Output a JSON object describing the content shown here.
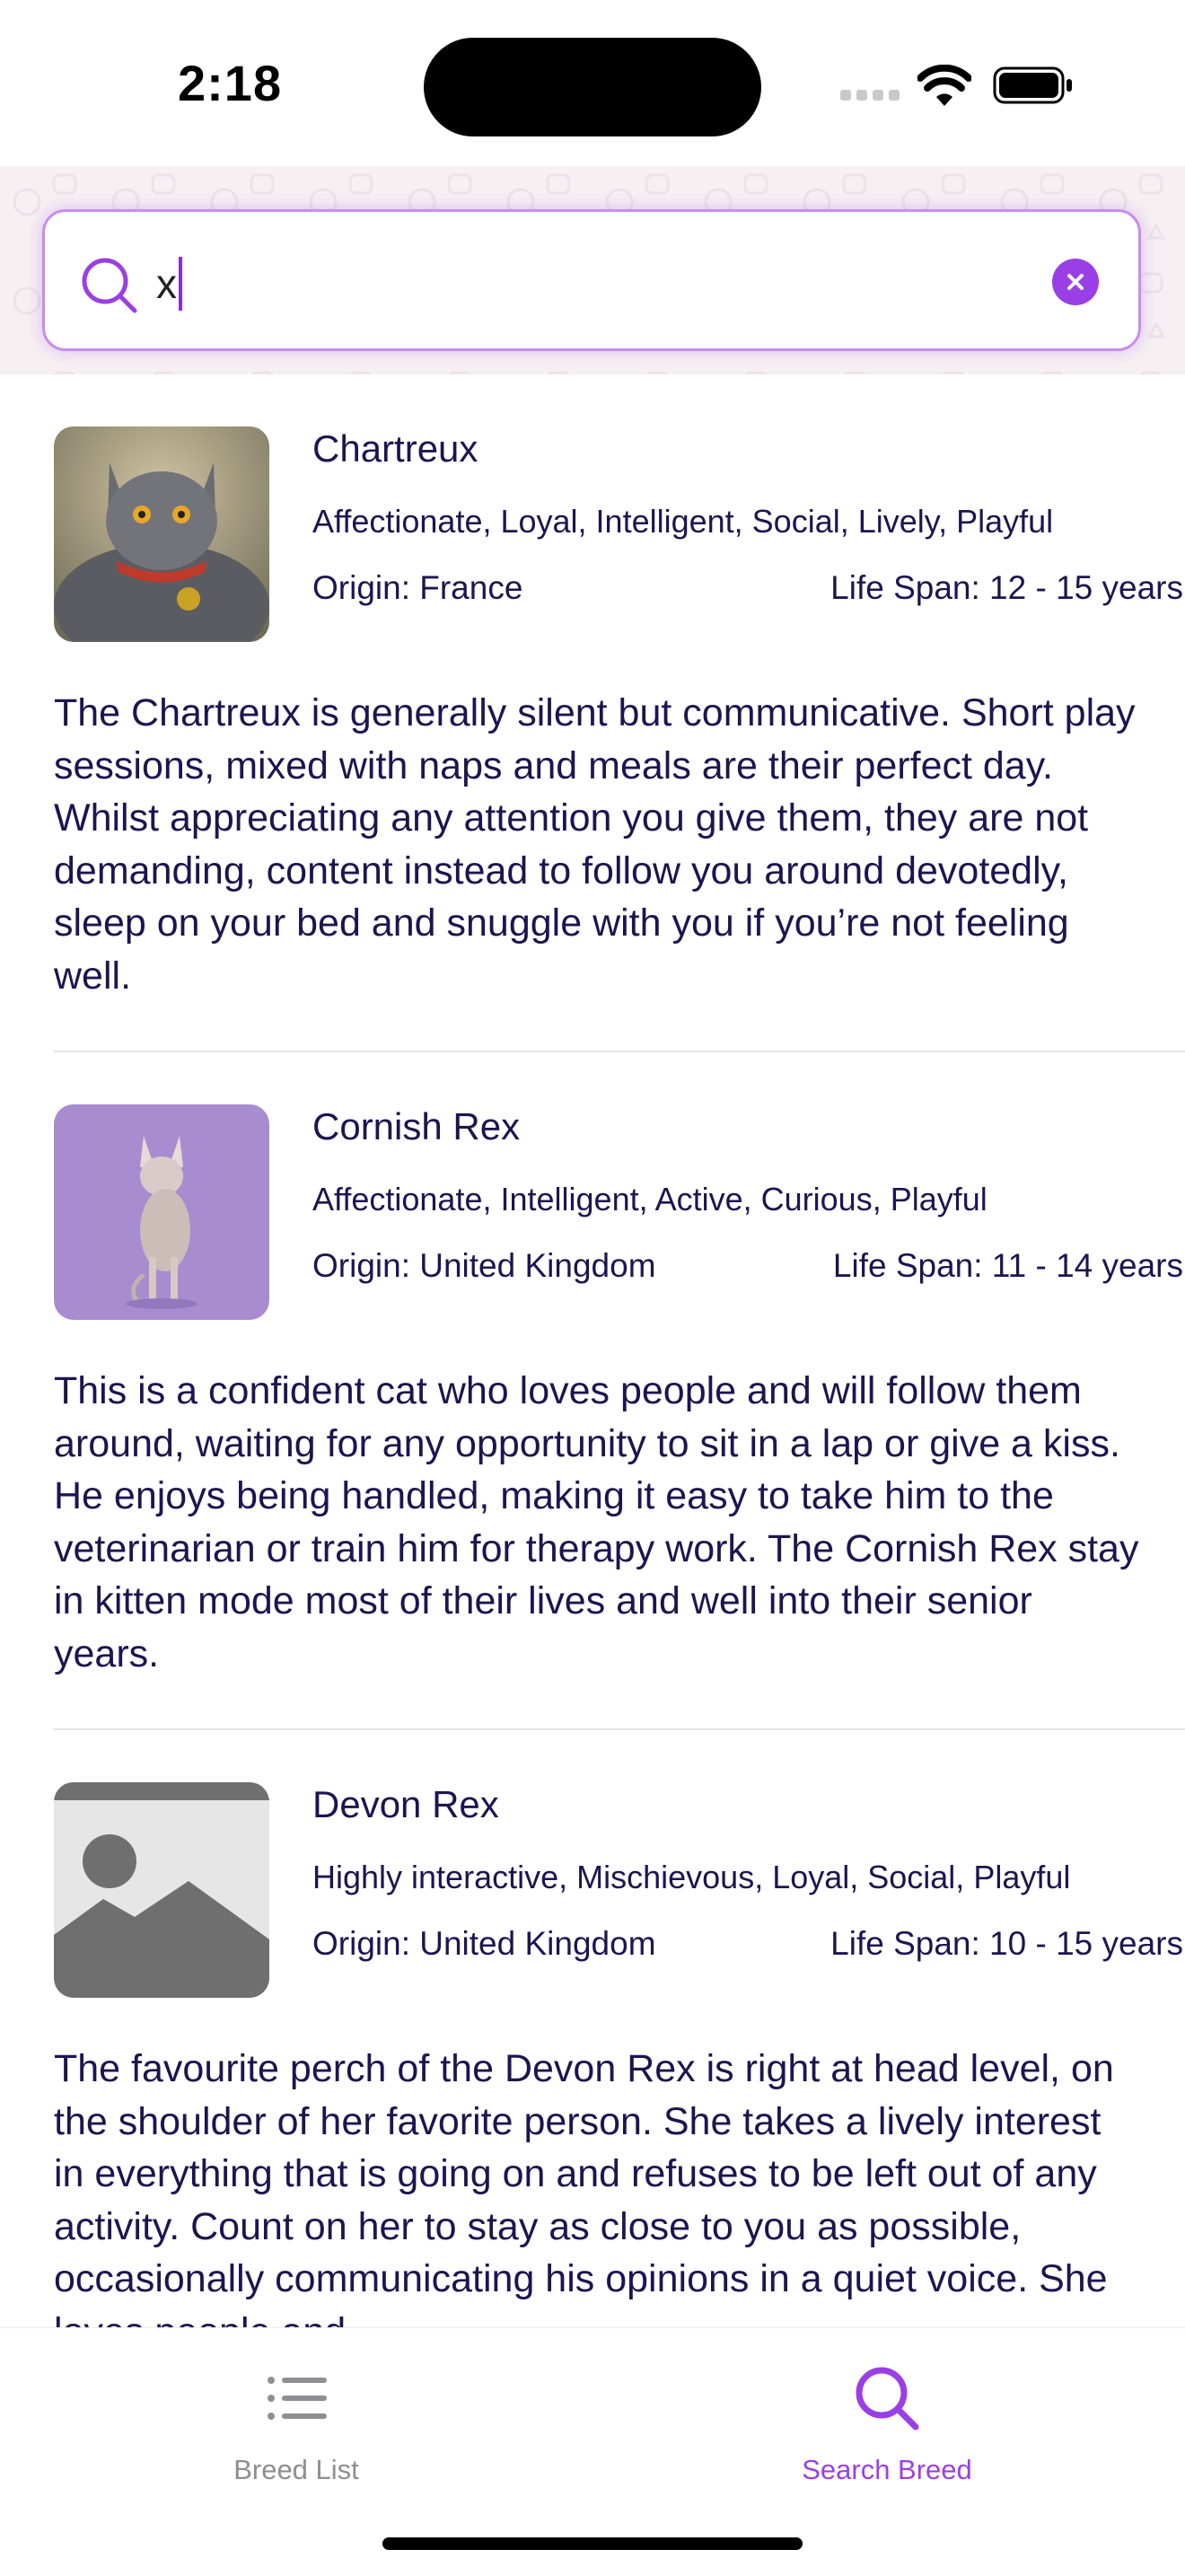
{
  "status_bar": {
    "time": "2:18"
  },
  "search": {
    "query": "x"
  },
  "breeds": [
    {
      "name": "Chartreux",
      "temperament": "Affectionate, Loyal, Intelligent, Social, Lively, Playful",
      "origin": "Origin: France",
      "life_span": "Life Span: 12 - 15 years",
      "description": "The Chartreux is generally silent but communicative. Short play sessions, mixed with naps and meals are their perfect day. Whilst appreciating any attention you give them, they are not demanding, content instead to follow you around devotedly, sleep on your bed and snuggle with you if you’re not feeling well."
    },
    {
      "name": "Cornish Rex",
      "temperament": "Affectionate, Intelligent, Active, Curious, Playful",
      "origin": "Origin: United Kingdom",
      "life_span": "Life Span: 11 - 14 years",
      "description": "This is a confident cat who loves people and will follow them around, waiting for any opportunity to sit in a lap or give a kiss. He enjoys being handled, making it easy to take him to the veterinarian or train him for therapy work. The Cornish Rex stay in kitten mode most of their lives and well into their senior years."
    },
    {
      "name": "Devon Rex",
      "temperament": "Highly interactive, Mischievous, Loyal, Social, Playful",
      "origin": "Origin: United Kingdom",
      "life_span": "Life Span: 10 - 15 years",
      "description": "The favourite perch of the Devon Rex is right at head level, on the shoulder of her favorite person. She takes a lively interest in everything that is going on and refuses to be left out of any activity. Count on her to stay as close to you as possible, occasionally communicating his opinions in a quiet voice. She loves people and"
    }
  ],
  "tabs": [
    {
      "label": "Breed List",
      "icon": "list-icon",
      "active": false
    },
    {
      "label": "Search Breed",
      "icon": "search-icon",
      "active": true
    }
  ],
  "colors": {
    "accent": "#9a3fe6",
    "text": "#1d1550",
    "inactive": "#8e8e93"
  }
}
